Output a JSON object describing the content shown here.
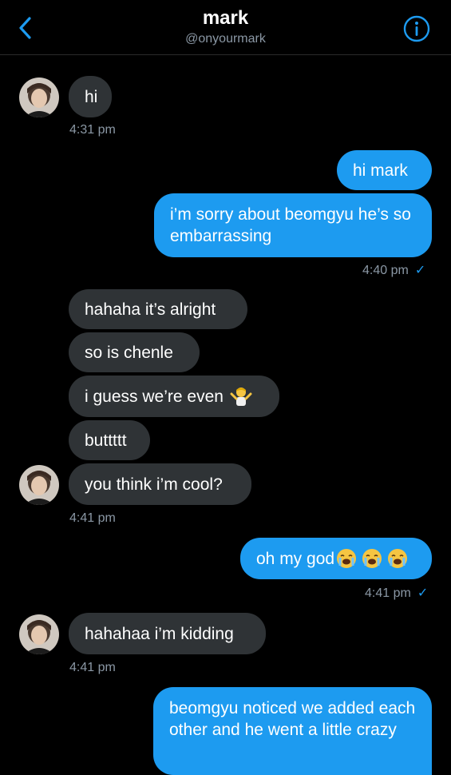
{
  "header": {
    "title": "mark",
    "handle": "@onyourmark",
    "back_icon": "chevron-left-icon",
    "info_icon": "info-icon",
    "accent": "#1d9bf0"
  },
  "messages": {
    "m1": "hi",
    "t1": "4:31 pm",
    "m2": "hi mark",
    "m3": "i’m sorry about beomgyu he’s so embarrassing",
    "t2": "4:40 pm",
    "m4": "hahaha it’s alright",
    "m5": "so is chenle",
    "m6": "i guess we’re even",
    "m7": "buttttt",
    "m8": "you think i’m cool?",
    "t3": "4:41 pm",
    "m9": "oh my god",
    "t4": "4:41 pm",
    "m10": "hahahaa i’m kidding",
    "t5": "4:41 pm",
    "m11": "beomgyu noticed we added each other and he went a little crazy",
    "check": "✓"
  },
  "colors": {
    "incoming_bubble": "#2f3336",
    "outgoing_bubble": "#1d9bf0",
    "timestamp": "#8b98a5",
    "background": "#000000"
  }
}
